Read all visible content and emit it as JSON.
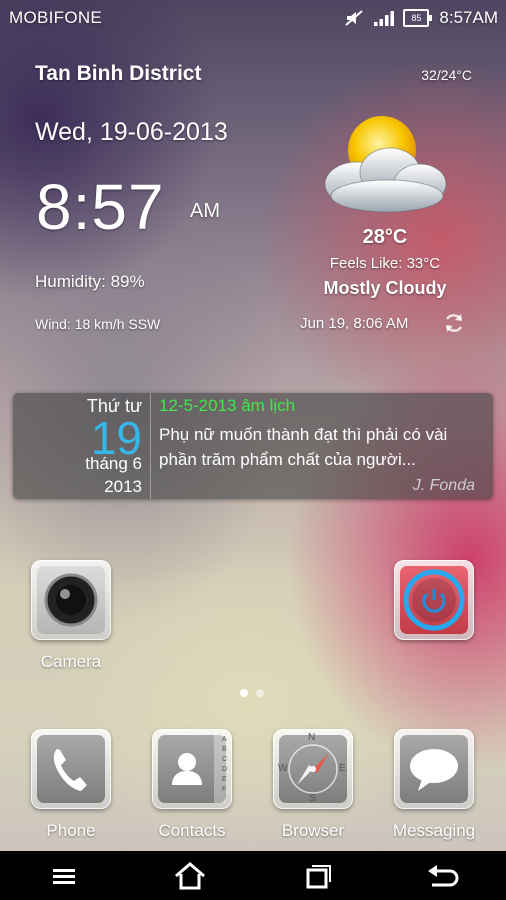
{
  "status_bar": {
    "carrier": "MOBIFONE",
    "battery_level": "85",
    "time": "8:57AM",
    "icons": [
      "mute-icon",
      "signal-icon",
      "battery-icon"
    ]
  },
  "weather": {
    "location": "Tan Binh District",
    "high_low": "32/24°C",
    "date": "Wed, 19-06-2013",
    "time": "8:57",
    "ampm": "AM",
    "humidity": "Humidity: 89%",
    "wind": "Wind: 18 km/h SSW",
    "temperature": "28°C",
    "feels_like": "Feels Like: 33°C",
    "condition": "Mostly Cloudy",
    "updated": "Jun 19, 8:06 AM",
    "icon": "partly-cloudy-icon"
  },
  "calendar": {
    "weekday": "Thứ tư",
    "day": "19",
    "month": "tháng 6",
    "year": "2013",
    "lunar_date": "12-5-2013 âm lịch",
    "quote": "Phụ nữ muốn thành đạt thì phải có vài phần trăm phẩm chất của người...",
    "author": "J. Fonda"
  },
  "home_apps": [
    {
      "label": "Camera",
      "icon": "camera-icon"
    },
    {
      "label": "",
      "icon": "power-icon"
    }
  ],
  "dock": [
    {
      "label": "Phone",
      "icon": "phone-icon"
    },
    {
      "label": "Contacts",
      "icon": "contacts-icon"
    },
    {
      "label": "Browser",
      "icon": "compass-icon"
    },
    {
      "label": "Messaging",
      "icon": "messaging-icon"
    }
  ],
  "contacts_index": "ABCDEF",
  "compass_letters": [
    "N",
    "E",
    "S",
    "W"
  ],
  "page_indicator": {
    "pages": 2,
    "current": 1
  },
  "nav_bar": [
    "menu-icon",
    "home-icon",
    "recent-apps-icon",
    "back-icon"
  ],
  "colors": {
    "accent_blue": "#35b7e8",
    "lunar_green": "#3ee84a",
    "power_red": "#d94a55"
  }
}
